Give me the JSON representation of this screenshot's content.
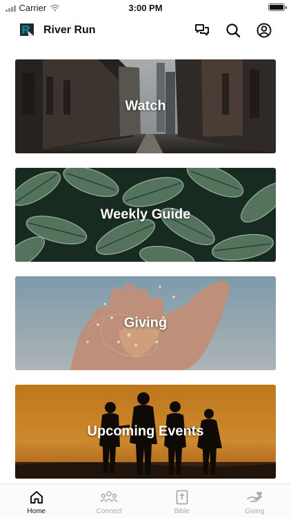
{
  "status_bar": {
    "carrier": "Carrier",
    "time": "3:00 PM"
  },
  "header": {
    "title": "River Run",
    "icons": [
      "chat-icon",
      "search-icon",
      "profile-icon"
    ]
  },
  "cards": [
    {
      "label": "Watch",
      "image": "city-street-photo"
    },
    {
      "label": "Weekly Guide",
      "image": "green-leaves-photo"
    },
    {
      "label": "Giving",
      "image": "hands-with-lights-photo"
    },
    {
      "label": "Upcoming Events",
      "image": "sunset-silhouettes-photo"
    }
  ],
  "tabs": [
    {
      "label": "Home",
      "icon": "home-icon",
      "active": true
    },
    {
      "label": "Connect",
      "icon": "people-icon",
      "active": false
    },
    {
      "label": "Bible",
      "icon": "bible-icon",
      "active": false
    },
    {
      "label": "Giving",
      "icon": "giving-hand-icon",
      "active": false
    }
  ],
  "colors": {
    "brand": "#1b7a8a",
    "active_tab": "#111111",
    "inactive_tab": "#a9a9a9"
  }
}
